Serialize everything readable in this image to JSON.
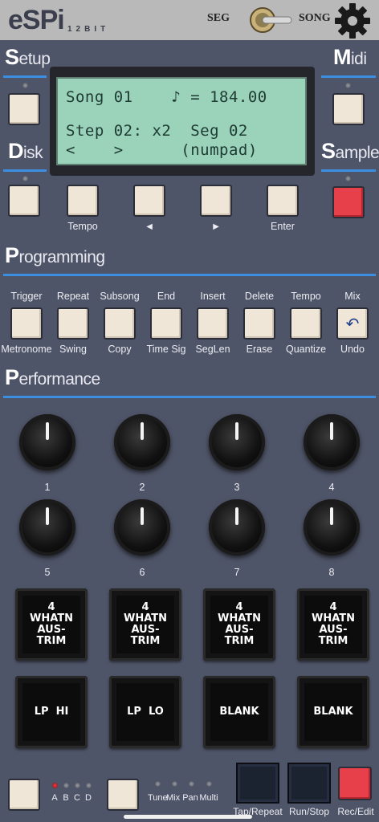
{
  "header": {
    "logo": "eSPi",
    "subtitle": "12BIT",
    "seg_label": "SEG",
    "song_label": "SONG"
  },
  "sections": {
    "setup": {
      "first": "S",
      "rest": "etup"
    },
    "midi": {
      "first": "M",
      "rest": "idi"
    },
    "disk": {
      "first": "D",
      "rest": "isk"
    },
    "sample": {
      "first": "S",
      "rest": "ample"
    },
    "programming": {
      "first": "P",
      "rest": "rogramming"
    },
    "performance": {
      "first": "P",
      "rest": "erformance"
    }
  },
  "lcd": {
    "line1": "Song 01    ♪ = 184.00",
    "line2": "Step 02: x2  Seg 02",
    "line3": "<    >      (numpad)"
  },
  "nav_labels": [
    "Tempo",
    "◄",
    "►",
    "Enter"
  ],
  "programming": {
    "top": [
      "Trigger",
      "Repeat",
      "Subsong",
      "End",
      "Insert",
      "Delete",
      "Tempo",
      "Mix"
    ],
    "bottom": [
      "Metronome",
      "Swing",
      "Copy",
      "Time Sig",
      "SegLen",
      "Erase",
      "Quantize",
      "Undo"
    ],
    "undo_icon": "↶"
  },
  "knobs": [
    "1",
    "2",
    "3",
    "4",
    "5",
    "6",
    "7",
    "8"
  ],
  "pads": [
    "4\nWHATN\nAUS-\nTRIM",
    "4\nWHATN\nAUS-\nTRIM",
    "4\nWHATN\nAUS-\nTRIM",
    "4\nWHATN\nAUS-\nTRIM",
    "LP  HI",
    "LP  LO",
    "BLANK",
    "BLANK"
  ],
  "footer": {
    "bank_labels": [
      "A",
      "B",
      "C",
      "D"
    ],
    "mode_labels": [
      "Tune",
      "Mix",
      "Pan",
      "Multi"
    ],
    "tap_repeat": "Tap/Repeat",
    "run_stop": "Run/Stop",
    "rec_edit": "Rec/Edit"
  },
  "colors": {
    "background": "#4f5568",
    "accent_rule": "#3c8fe0",
    "lcd": "#9ad3ba",
    "record": "#e8404a"
  }
}
